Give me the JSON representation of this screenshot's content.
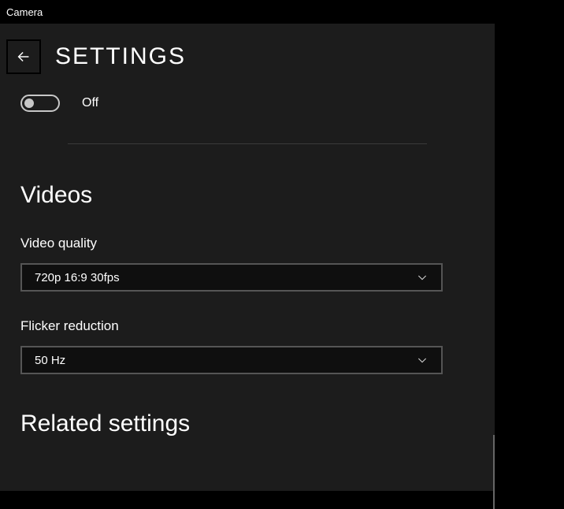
{
  "app": {
    "title": "Camera"
  },
  "header": {
    "title": "SETTINGS"
  },
  "toggle": {
    "state": false,
    "label": "Off"
  },
  "sections": {
    "videos_title": "Videos",
    "video_quality": {
      "label": "Video quality",
      "value": "720p 16:9 30fps"
    },
    "flicker_reduction": {
      "label": "Flicker reduction",
      "value": "50 Hz"
    },
    "related_title": "Related settings"
  }
}
